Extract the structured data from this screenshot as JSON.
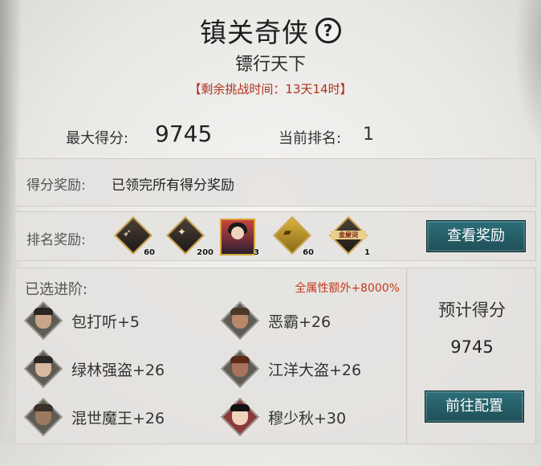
{
  "header": {
    "title": "镇关奇侠",
    "help_glyph": "?",
    "subtitle": "镖行天下",
    "timer": "【剩余挑战时间：13天14时】"
  },
  "stats": {
    "max_score_label": "最大得分:",
    "max_score_value": "9745",
    "rank_label": "当前排名:",
    "rank_value": "1"
  },
  "score_reward": {
    "label": "得分奖励:",
    "value": "已领完所有得分奖励"
  },
  "rank_reward": {
    "label": "排名奖励:",
    "items": [
      {
        "icon": "arrows-icon",
        "count": "60"
      },
      {
        "icon": "dark-token-icon",
        "count": "200"
      },
      {
        "icon": "hero-card-icon",
        "count": "3"
      },
      {
        "icon": "gold-book-icon",
        "count": "60"
      },
      {
        "icon": "title-plaque-icon",
        "count": "1",
        "text": "金屋词"
      }
    ],
    "button": "查看奖励"
  },
  "advance": {
    "title": "已选进阶:",
    "bonus": "全属性额外+8000%",
    "heroes": [
      {
        "label": "包打听+5"
      },
      {
        "label": "恶霸+26"
      },
      {
        "label": "绿林强盗+26"
      },
      {
        "label": "江洋大盗+26"
      },
      {
        "label": "混世魔王+26"
      },
      {
        "label": "穆少秋+30"
      }
    ]
  },
  "estimate": {
    "label": "预计得分",
    "value": "9745",
    "button": "前往配置"
  },
  "colors": {
    "accent_red": "#b0311c",
    "button_teal": "#2d6f79"
  }
}
